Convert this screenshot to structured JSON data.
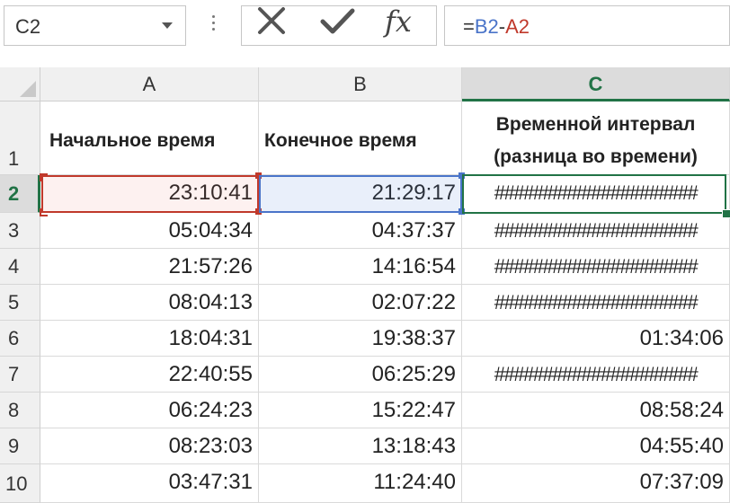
{
  "formula_bar": {
    "name_box": "C2",
    "cancel_icon": "close-icon",
    "enter_icon": "checkmark-icon",
    "fx_label": "fx",
    "formula": {
      "eq": "=",
      "ref1": "B2",
      "op": "-",
      "ref2": "A2"
    }
  },
  "columns": [
    "A",
    "B",
    "C"
  ],
  "header_row": {
    "row_label": "1",
    "a": "Начальное время",
    "b": "Конечное время",
    "c_line1": "Временной интервал",
    "c_line2": "(разница во времени)"
  },
  "rows": [
    {
      "n": "2",
      "a": "23:10:41",
      "b": "21:29:17",
      "c": "#####################"
    },
    {
      "n": "3",
      "a": "05:04:34",
      "b": "04:37:37",
      "c": "#####################"
    },
    {
      "n": "4",
      "a": "21:57:26",
      "b": "14:16:54",
      "c": "#####################"
    },
    {
      "n": "5",
      "a": "08:04:13",
      "b": "02:07:22",
      "c": "#####################"
    },
    {
      "n": "6",
      "a": "18:04:31",
      "b": "19:38:37",
      "c": "01:34:06"
    },
    {
      "n": "7",
      "a": "22:40:55",
      "b": "06:25:29",
      "c": "#####################"
    },
    {
      "n": "8",
      "a": "06:24:23",
      "b": "15:22:47",
      "c": "08:58:24"
    },
    {
      "n": "9",
      "a": "08:23:03",
      "b": "13:18:43",
      "c": "04:55:40"
    },
    {
      "n": "10",
      "a": "03:47:31",
      "b": "11:24:40",
      "c": "07:37:09"
    }
  ],
  "colors": {
    "selection_green": "#217346",
    "ref_red": "#c0392b",
    "ref_blue": "#4a74c9"
  }
}
